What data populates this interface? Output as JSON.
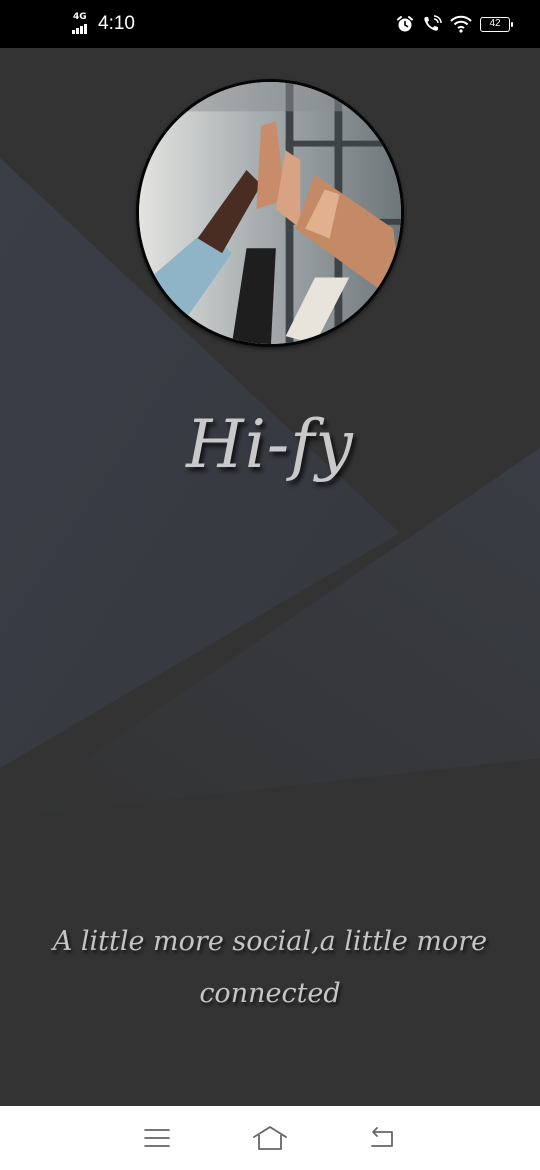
{
  "status_bar": {
    "network_type": "4G",
    "time": "4:10",
    "battery_level": "42",
    "icons": [
      "signal-icon",
      "alarm-icon",
      "wifi-call-icon",
      "wifi-icon",
      "battery-icon"
    ]
  },
  "splash": {
    "app_name": "Hi-fy",
    "tagline": "A little more social,a little more connected",
    "hero_image": "hands-high-five-image"
  },
  "nav_bar": {
    "icons": [
      "menu-icon",
      "home-icon",
      "back-icon"
    ]
  },
  "colors": {
    "background": "#333333",
    "accent_shape": "#373a42",
    "text": "#c9c9c9",
    "status_bar": "#000000",
    "nav_bar": "#ffffff"
  }
}
